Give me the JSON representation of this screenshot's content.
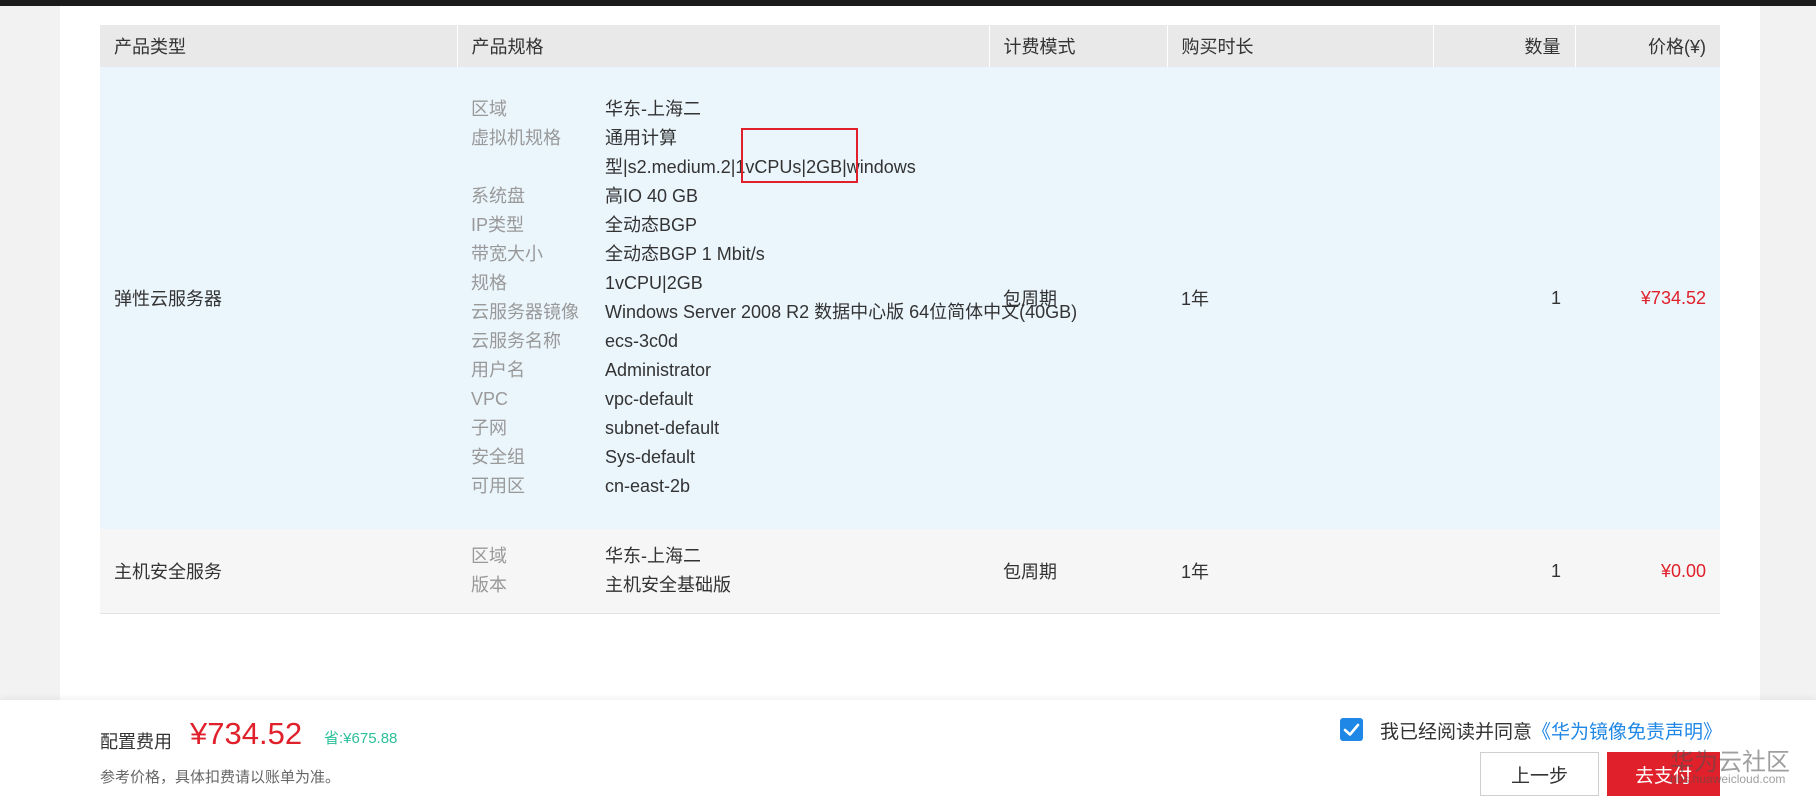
{
  "table": {
    "headers": [
      "产品类型",
      "产品规格",
      "计费模式",
      "购买时长",
      "数量",
      "价格(¥)"
    ],
    "rows": [
      {
        "type": "弹性云服务器",
        "specs": [
          {
            "k": "区域",
            "v": "华东-上海二"
          },
          {
            "k": "虚拟机规格",
            "v": "通用计算型|s2.medium.2|1vCPUs|2GB|windows"
          },
          {
            "k": "系统盘",
            "v": "高IO 40 GB"
          },
          {
            "k": "IP类型",
            "v": "全动态BGP"
          },
          {
            "k": "带宽大小",
            "v": "全动态BGP 1 Mbit/s"
          },
          {
            "k": "规格",
            "v": "1vCPU|2GB"
          },
          {
            "k": "云服务器镜像",
            "v": "Windows Server 2008 R2 数据中心版 64位简体中文(40GB)"
          },
          {
            "k": "云服务名称",
            "v": "ecs-3c0d"
          },
          {
            "k": "用户名",
            "v": "Administrator"
          },
          {
            "k": "VPC",
            "v": "vpc-default"
          },
          {
            "k": "子网",
            "v": "subnet-default"
          },
          {
            "k": "安全组",
            "v": "Sys-default"
          },
          {
            "k": "可用区",
            "v": "cn-east-2b"
          }
        ],
        "billing": "包周期",
        "duration": "1年",
        "quantity": "1",
        "price": "¥734.52"
      },
      {
        "type": "主机安全服务",
        "specs": [
          {
            "k": "区域",
            "v": "华东-上海二"
          },
          {
            "k": "版本",
            "v": "主机安全基础版"
          }
        ],
        "billing": "包周期",
        "duration": "1年",
        "quantity": "1",
        "price": "¥0.00"
      }
    ]
  },
  "footer": {
    "fee_label": "配置费用",
    "fee_amount": "¥734.52",
    "fee_save": "省:¥675.88",
    "fee_note": "参考价格，具体扣费请以账单为准。",
    "agree_text": "我已经阅读并同意",
    "agree_link": "《华为镜像免责声明》",
    "agree_checked": true,
    "prev_button": "上一步",
    "pay_button": "去支付"
  },
  "watermark": {
    "title": "华为云社区",
    "url": "bbs.huaweicloud.com"
  },
  "colors": {
    "accent_red": "#e0202a",
    "link_blue": "#1f87e6",
    "save_green": "#2bbf9a",
    "row_highlight": "#eaf5fc"
  }
}
